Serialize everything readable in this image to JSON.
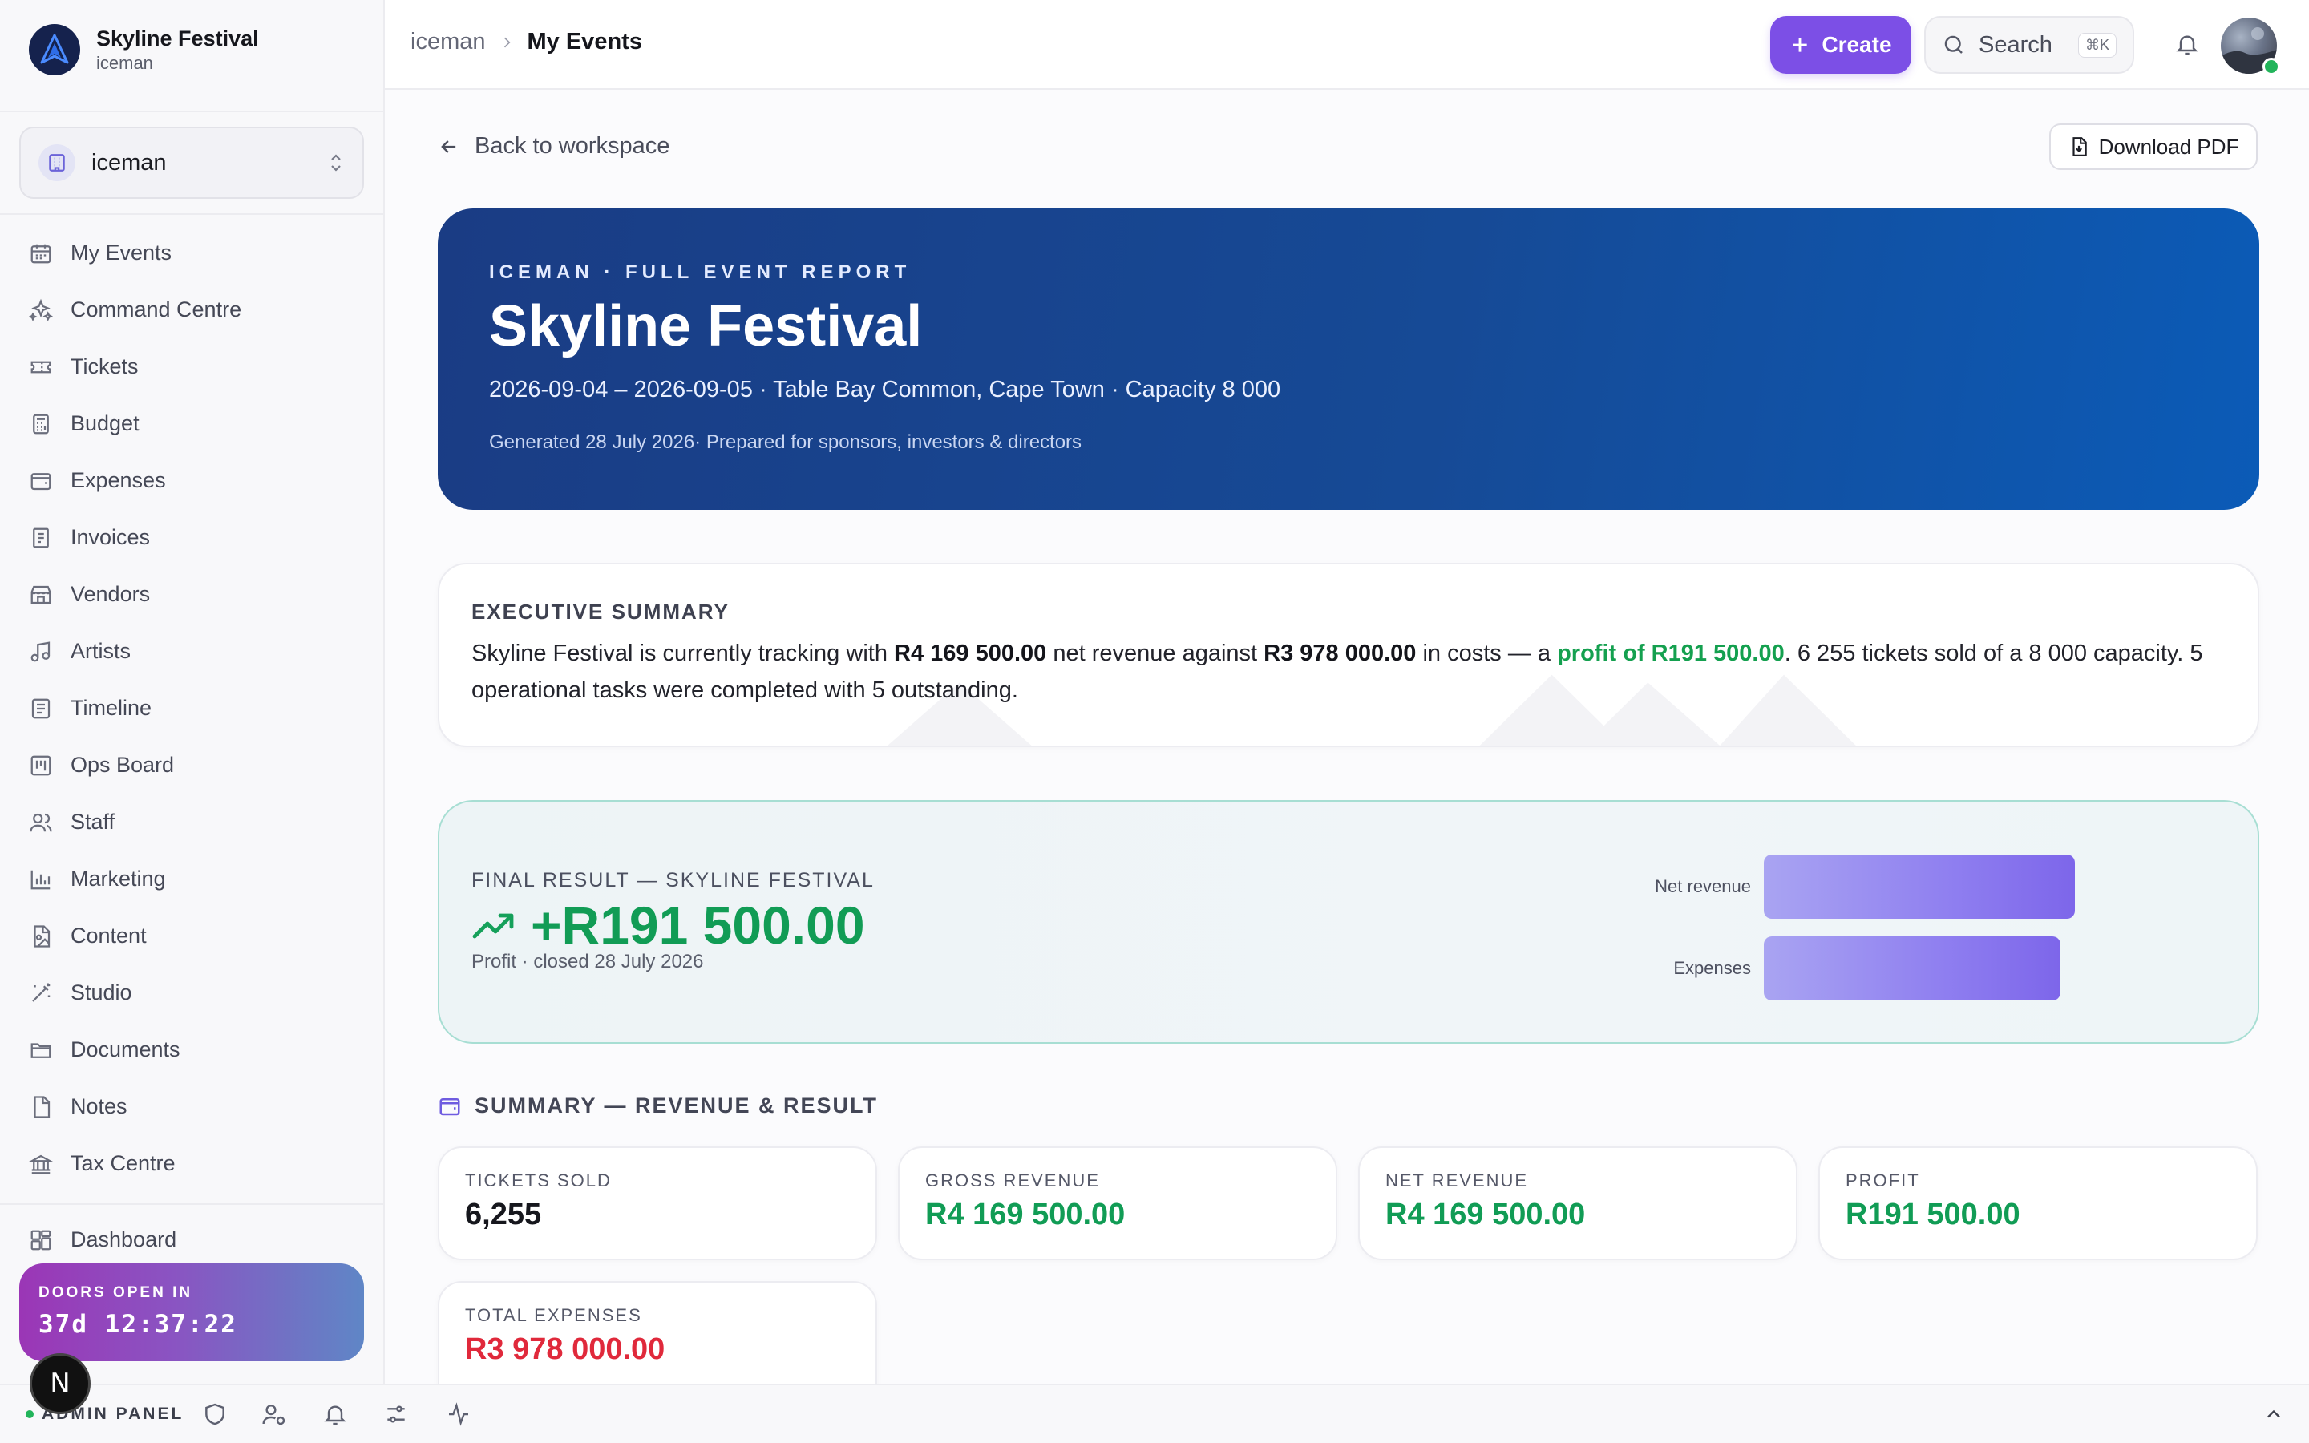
{
  "brand": {
    "name": "Skyline Festival",
    "sub": "iceman"
  },
  "org_select": {
    "label": "iceman"
  },
  "nav": [
    {
      "label": "My Events",
      "icon": "calendar-icon"
    },
    {
      "label": "Command Centre",
      "icon": "sparkles-icon"
    },
    {
      "label": "Tickets",
      "icon": "ticket-icon"
    },
    {
      "label": "Budget",
      "icon": "calculator-icon"
    },
    {
      "label": "Expenses",
      "icon": "wallet-icon"
    },
    {
      "label": "Invoices",
      "icon": "invoice-icon"
    },
    {
      "label": "Vendors",
      "icon": "store-icon"
    },
    {
      "label": "Artists",
      "icon": "music-icon"
    },
    {
      "label": "Timeline",
      "icon": "list-icon"
    },
    {
      "label": "Ops Board",
      "icon": "kanban-icon"
    },
    {
      "label": "Staff",
      "icon": "users-icon"
    },
    {
      "label": "Marketing",
      "icon": "bar-chart-icon"
    },
    {
      "label": "Content",
      "icon": "file-image-icon"
    },
    {
      "label": "Studio",
      "icon": "wand-icon"
    },
    {
      "label": "Documents",
      "icon": "folder-icon"
    },
    {
      "label": "Notes",
      "icon": "file-icon"
    },
    {
      "label": "Tax Centre",
      "icon": "landmark-icon"
    },
    {
      "label": "Dashboard",
      "icon": "layout-icon"
    }
  ],
  "countdown": {
    "label": "DOORS OPEN IN",
    "time": "37d  12:37:22"
  },
  "badge": {
    "letter": "N"
  },
  "admin_panel": {
    "label": "ADMIN PANEL"
  },
  "breadcrumb": {
    "parent": "iceman",
    "current": "My Events"
  },
  "header": {
    "create_label": "Create",
    "search_label": "Search",
    "search_shortcut": "⌘K"
  },
  "actions": {
    "back_label": "Back to workspace",
    "pdf_label": "Download PDF"
  },
  "hero": {
    "eyebrow": "ICEMAN · FULL EVENT REPORT",
    "title": "Skyline Festival",
    "meta": "2026-09-04 – 2026-09-05 · Table Bay Common, Cape Town · Capacity 8 000",
    "generated": "Generated 28 July 2026· Prepared for sponsors, investors & directors"
  },
  "executive_summary": {
    "title": "EXECUTIVE SUMMARY",
    "text_1": "Skyline Festival is currently tracking with ",
    "net_revenue": "R4 169 500.00",
    "text_2": " net revenue against ",
    "costs": "R3 978 000.00",
    "text_3": " in costs — a ",
    "profit_phrase": "profit of R191 500.00",
    "text_4": ". 6 255 tickets sold of a 8 000 capacity. 5 operational tasks were completed with 5 outstanding."
  },
  "final_result": {
    "eyebrow": "FINAL RESULT — SKYLINE FESTIVAL",
    "amount": "+R191 500.00",
    "note": "Profit · closed 28 July 2026",
    "bars": [
      {
        "label": "Net revenue",
        "value": 4169500
      },
      {
        "label": "Expenses",
        "value": 3978000
      }
    ]
  },
  "summary": {
    "title": "SUMMARY — REVENUE & RESULT",
    "cards": [
      {
        "label": "TICKETS SOLD",
        "value": "6,255",
        "color": "#16171d"
      },
      {
        "label": "GROSS REVENUE",
        "value": "R4 169 500.00",
        "color": "#119c55"
      },
      {
        "label": "NET REVENUE",
        "value": "R4 169 500.00",
        "color": "#119c55"
      },
      {
        "label": "PROFIT",
        "value": "R191 500.00",
        "color": "#119c55"
      },
      {
        "label": "TOTAL EXPENSES",
        "value": "R3 978 000.00",
        "color": "#e0293b"
      }
    ]
  },
  "colors": {
    "accent": "#7c4fe6",
    "hero_start": "#1a3c84",
    "hero_end": "#0b5bb7",
    "positive": "#119c55",
    "negative": "#e0293b"
  }
}
